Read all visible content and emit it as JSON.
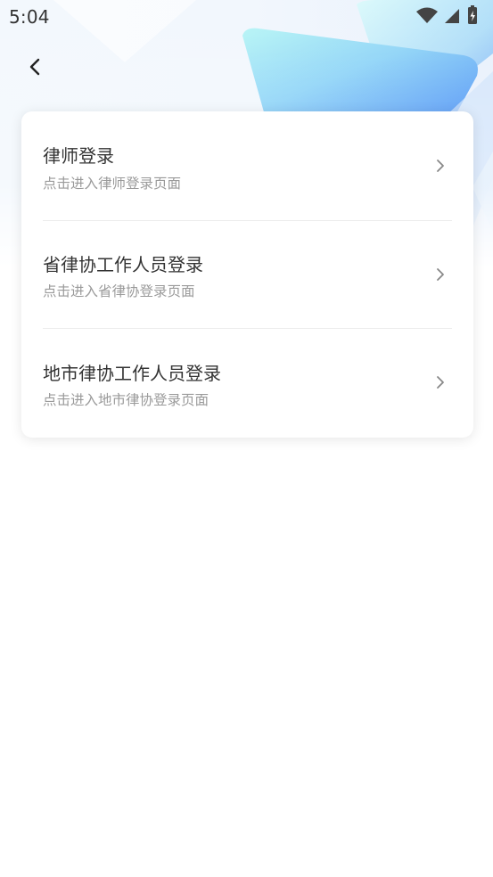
{
  "status_bar": {
    "time": "5:04"
  },
  "header": {
    "back_icon": "chevron-left-icon"
  },
  "login_options": [
    {
      "title": "律师登录",
      "subtitle": "点击进入律师登录页面",
      "icon": "chevron-right-icon"
    },
    {
      "title": "省律协工作人员登录",
      "subtitle": "点击进入省律协登录页面",
      "icon": "chevron-right-icon"
    },
    {
      "title": "地市律协工作人员登录",
      "subtitle": "点击进入地市律协登录页面",
      "icon": "chevron-right-icon"
    }
  ],
  "colors": {
    "background": "#ffffff",
    "card": "#ffffff",
    "title_text": "#333333",
    "subtitle_text": "#9a9a9a",
    "accent_blue": "#4a8ef5",
    "accent_cyan": "#9ff0f5"
  }
}
